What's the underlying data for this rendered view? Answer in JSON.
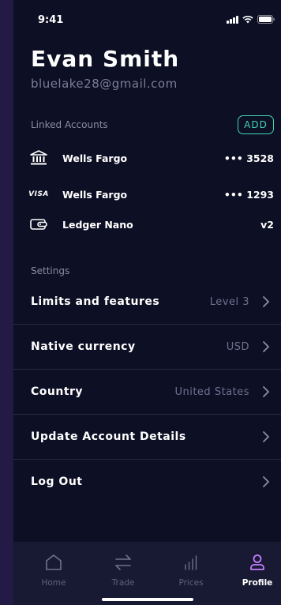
{
  "status_bar": {
    "time": "9:41"
  },
  "profile": {
    "name": "Evan Smith",
    "email": "bluelake28@gmail.com"
  },
  "linked_accounts": {
    "label": "Linked Accounts",
    "add_label": "ADD",
    "items": [
      {
        "icon": "bank-icon",
        "name": "Wells Fargo",
        "number": "••• 3528"
      },
      {
        "icon": "visa-icon",
        "icon_text": "VISA",
        "name": "Wells Fargo",
        "number": "••• 1293"
      },
      {
        "icon": "wallet-icon",
        "name": "Ledger Nano",
        "number": "v2"
      }
    ]
  },
  "settings": {
    "label": "Settings",
    "items": [
      {
        "label": "Limits and features",
        "value": "Level 3"
      },
      {
        "label": "Native currency",
        "value": "USD"
      },
      {
        "label": "Country",
        "value": "United States"
      },
      {
        "label": "Update Account Details",
        "value": ""
      },
      {
        "label": "Log Out",
        "value": ""
      }
    ]
  },
  "tabs": [
    {
      "label": "Home",
      "icon": "home-icon",
      "active": false
    },
    {
      "label": "Trade",
      "icon": "swap-icon",
      "active": false
    },
    {
      "label": "Prices",
      "icon": "bar-chart-icon",
      "active": false
    },
    {
      "label": "Profile",
      "icon": "user-icon",
      "active": true
    }
  ],
  "colors": {
    "background": "#0d0f24",
    "accent_green": "#43d6b4",
    "accent_purple": "#c77dff",
    "muted_text": "#7a7d98"
  }
}
